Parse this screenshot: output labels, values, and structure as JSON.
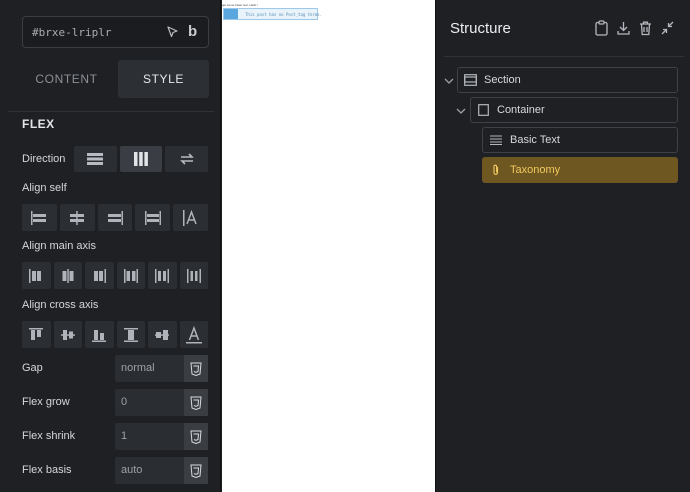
{
  "element_id": "#brxe-lriplr",
  "tabs": {
    "content": "CONTENT",
    "style": "STYLE"
  },
  "flex": {
    "title": "FLEX",
    "direction_label": "Direction",
    "align_self_label": "Align self",
    "align_main_label": "Align main axis",
    "align_cross_label": "Align cross axis",
    "gap": {
      "label": "Gap",
      "value": "normal"
    },
    "flex_grow": {
      "label": "Flex grow",
      "value": "0"
    },
    "flex_shrink": {
      "label": "Flex shrink",
      "value": "1"
    },
    "flex_basis": {
      "label": "Flex basis",
      "value": "auto"
    }
  },
  "canvas": {
    "top_text": "get some basic text.   Hello !",
    "notice_text": "This post has no Post_tag terms."
  },
  "structure": {
    "title": "Structure",
    "nodes": [
      {
        "label": "Section",
        "icon": "section-icon"
      },
      {
        "label": "Container",
        "icon": "container-icon"
      },
      {
        "label": "Basic Text",
        "icon": "text-lines-icon"
      },
      {
        "label": "Taxonomy",
        "icon": "paperclip-icon"
      }
    ]
  },
  "colors": {
    "accent_selected_bg": "#6f5722",
    "accent_selected_text": "#f0c95f"
  }
}
